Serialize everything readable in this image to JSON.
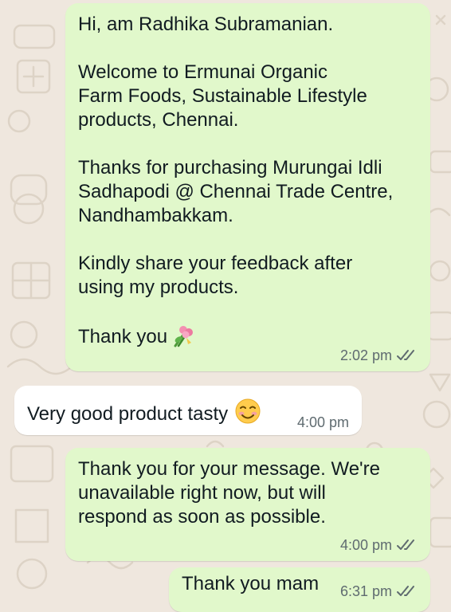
{
  "messages": [
    {
      "direction": "outgoing",
      "text": "Hi, am Radhika Subramanian.\n\nWelcome to Ermunai Organic\nFarm Foods, Sustainable Lifestyle\nproducts, Chennai.\n\nThanks for purchasing Murungai Idli\nSadhapodi @ Chennai Trade Centre,\nNandhambakkam.\n\nKindly share your feedback after\nusing my products.\n\nThank you",
      "emoji": "bouquet",
      "time": "2:02 pm",
      "status": "double-check-read"
    },
    {
      "direction": "incoming",
      "text": "Very good product tasty",
      "emoji": "smiling-face-blushing",
      "time": "4:00 pm"
    },
    {
      "direction": "outgoing",
      "text": "Thank you for your message. We're\nunavailable right now, but will\nrespond as soon as possible.",
      "time": "4:00 pm",
      "status": "double-check-read"
    },
    {
      "direction": "outgoing",
      "text": "Thank you mam",
      "time": "6:31 pm",
      "status": "double-check-read"
    }
  ],
  "colors": {
    "outgoing_bubble": "#e1f8cb",
    "incoming_bubble": "#ffffff",
    "wallpaper": "#efe7de",
    "text": "#111b21",
    "meta": "#5f6b70"
  }
}
